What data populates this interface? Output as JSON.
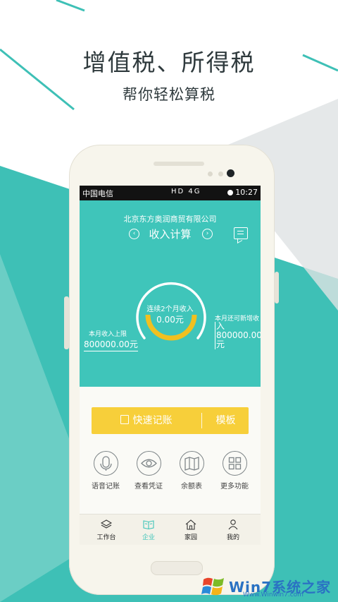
{
  "hero": {
    "title": "增值税、所得税",
    "subtitle": "帮你轻松算税"
  },
  "status_bar": {
    "carrier": "中国电信",
    "icons": "HD 4G",
    "time": "10:27"
  },
  "header": {
    "company": "北京东方奥润商贸有限公司",
    "title": "收入计算",
    "prev": "‹",
    "next": "›"
  },
  "gauge": {
    "label": "连续2个月收入",
    "value": "0.00元",
    "progress_fraction": 0.0,
    "left_label": "本月收入上限",
    "left_value": "800000.00元",
    "right_label": "本月还可新增收",
    "right_value": "入800000.00元"
  },
  "actions": {
    "quick_entry": "快速记账",
    "template": "模板"
  },
  "functions": [
    {
      "label": "语音记账",
      "icon": "microphone-icon"
    },
    {
      "label": "查看凭证",
      "icon": "eye-icon"
    },
    {
      "label": "余额表",
      "icon": "map-icon"
    },
    {
      "label": "更多功能",
      "icon": "grid-icon"
    }
  ],
  "tabs": [
    {
      "label": "工作台",
      "icon": "layers-icon",
      "active": false
    },
    {
      "label": "企业",
      "icon": "book-icon",
      "active": true
    },
    {
      "label": "家园",
      "icon": "home-icon",
      "active": false
    },
    {
      "label": "我的",
      "icon": "person-icon",
      "active": false
    }
  ],
  "watermark": {
    "name": "Win7系统之家",
    "url": "Www.Winwin7.com"
  },
  "colors": {
    "teal": "#3fc5ba",
    "yellow": "#f7cf3a",
    "gauge_ring": "#ffffff",
    "gauge_arc": "#f0c020"
  }
}
